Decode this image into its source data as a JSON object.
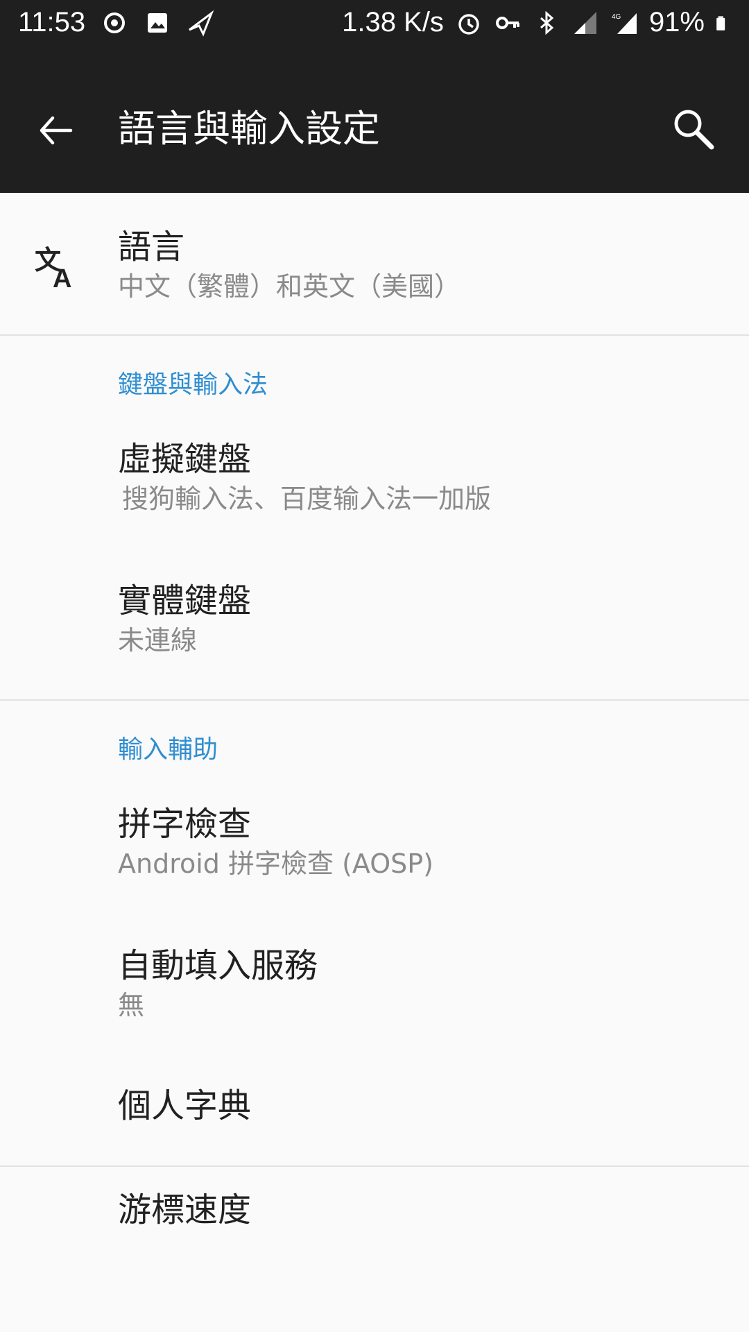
{
  "status_bar": {
    "time": "11:53",
    "net_speed": "1.38 K/s",
    "battery": "91%"
  },
  "app_bar": {
    "title": "語言與輸入設定"
  },
  "language": {
    "title": "語言",
    "subtitle": "中文（繁體）和英文（美國）"
  },
  "sections": {
    "keyboard": {
      "header": "鍵盤與輸入法",
      "virtual_keyboard": {
        "title": "虛擬鍵盤",
        "subtitle": "搜狗輸入法、百度输入法一加版"
      },
      "physical_keyboard": {
        "title": "實體鍵盤",
        "subtitle": "未連線"
      }
    },
    "input_assist": {
      "header": "輸入輔助",
      "spell_check": {
        "title": "拼字檢查",
        "subtitle": "Android 拼字檢查 (AOSP)"
      },
      "autofill": {
        "title": "自動填入服務",
        "subtitle": "無"
      },
      "personal_dictionary": {
        "title": "個人字典"
      }
    },
    "pointer": {
      "pointer_speed": {
        "title": "游標速度"
      }
    }
  }
}
